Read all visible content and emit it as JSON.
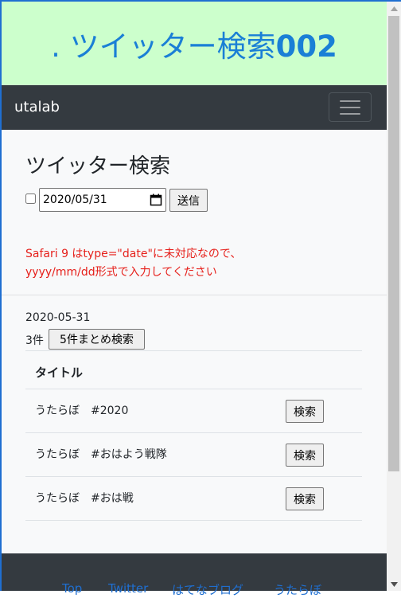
{
  "banner": {
    "title_prefix": ". ツイッター検索",
    "title_number": "002"
  },
  "navbar": {
    "brand": "utalab"
  },
  "form": {
    "heading": "ツイッター検索",
    "date_value": "2020/05/31",
    "submit_label": "送信",
    "warning_line1": "Safari 9 はtype=\"date\"に未対応なので、",
    "warning_line2": "yyyy/mm/dd形式で入力してください"
  },
  "results": {
    "date": "2020-05-31",
    "count": "3件",
    "batch_label": "5件まとめ検索",
    "column_title": "タイトル",
    "rows": [
      {
        "title": "うたらぼ　#2020",
        "button": "検索"
      },
      {
        "title": "うたらぼ　#おはよう戦隊",
        "button": "検索"
      },
      {
        "title": "うたらぼ　#おは戦",
        "button": "検索"
      }
    ]
  },
  "footer": {
    "links": [
      "Top",
      "Twitter",
      "はてなブログ",
      "うたらぼ"
    ]
  },
  "colors": {
    "banner_bg": "#ccffcc",
    "title": "#1a7fd6",
    "navbar_bg": "#343a40",
    "warning": "#e6201b"
  },
  "icons": [
    "menu-icon",
    "calendar-icon"
  ]
}
